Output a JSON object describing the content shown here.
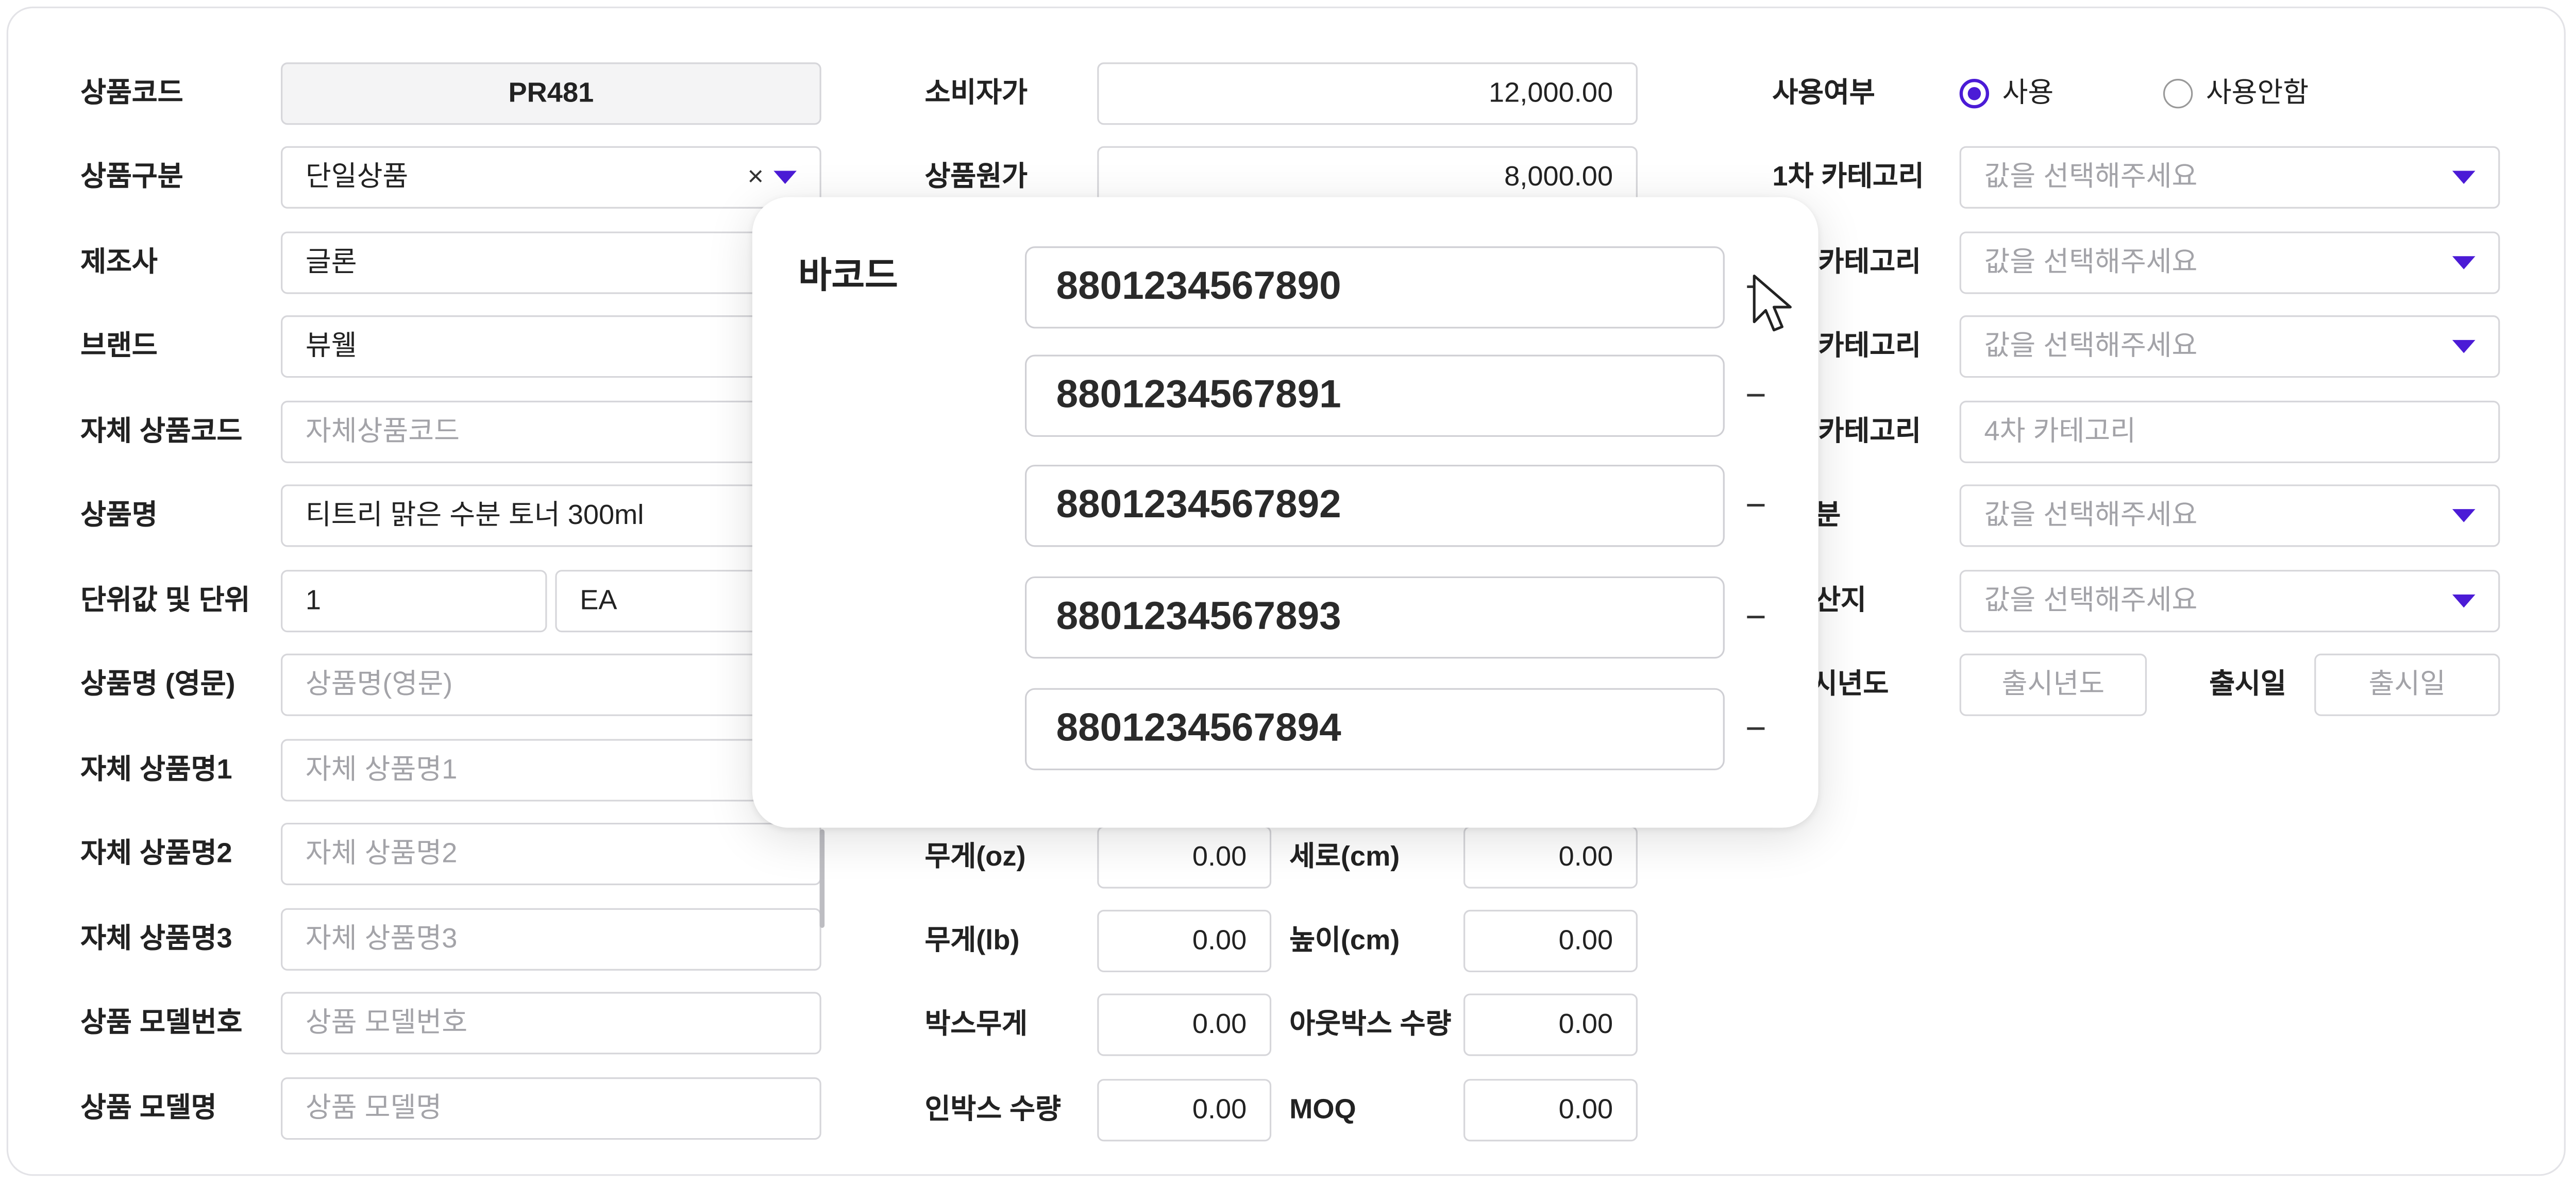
{
  "left": {
    "product_code": {
      "label": "상품코드",
      "value": "PR481"
    },
    "product_type": {
      "label": "상품구분",
      "value": "단일상품",
      "clear": "×"
    },
    "manufacturer": {
      "label": "제조사",
      "value": "글론"
    },
    "brand": {
      "label": "브랜드",
      "value": "뷰웰"
    },
    "own_code": {
      "label": "자체 상품코드",
      "placeholder": "자체상품코드"
    },
    "product_name": {
      "label": "상품명",
      "value": "티트리 맑은 수분 토너 300ml"
    },
    "unit": {
      "label": "단위값 및 단위",
      "value": "1",
      "unit_value": "EA"
    },
    "name_en": {
      "label": "상품명 (영문)",
      "placeholder": "상품명(영문)"
    },
    "own_name1": {
      "label": "자체 상품명1",
      "placeholder": "자체 상품명1"
    },
    "own_name2": {
      "label": "자체 상품명2",
      "placeholder": "자체 상품명2"
    },
    "own_name3": {
      "label": "자체 상품명3",
      "placeholder": "자체 상품명3"
    },
    "model_no": {
      "label": "상품 모델번호",
      "placeholder": "상품 모델번호"
    },
    "model_name": {
      "label": "상품 모델명",
      "placeholder": "상품 모델명"
    }
  },
  "middle": {
    "consumer_price": {
      "label": "소비자가",
      "value": "12,000.00"
    },
    "cost_price": {
      "label": "상품원가",
      "value": "8,000.00"
    },
    "weight_oz": {
      "label": "무게(oz)",
      "value": "0.00"
    },
    "depth_cm": {
      "label": "세로(cm)",
      "value": "0.00"
    },
    "weight_lb": {
      "label": "무게(lb)",
      "value": "0.00"
    },
    "height_cm": {
      "label": "높이(cm)",
      "value": "0.00"
    },
    "box_weight": {
      "label": "박스무게",
      "value": "0.00"
    },
    "outbox_qty": {
      "label": "아웃박스 수량",
      "value": "0.00"
    },
    "inbox_qty": {
      "label": "인박스 수량",
      "value": "0.00"
    },
    "moq": {
      "label": "MOQ",
      "value": "0.00"
    }
  },
  "right": {
    "use": {
      "label": "사용여부",
      "opt_on": "사용",
      "opt_off": "사용안함",
      "selected": "사용"
    },
    "cat1": {
      "label": "1차 카테고리",
      "placeholder": "값을 선택해주세요"
    },
    "cat2": {
      "label": "카테고리",
      "placeholder": "값을 선택해주세요"
    },
    "cat3": {
      "label": "카테고리",
      "placeholder": "값을 선택해주세요"
    },
    "cat4": {
      "label": "카테고리",
      "placeholder": "4차 카테고리"
    },
    "row5": {
      "label": "분",
      "placeholder": "값을 선택해주세요"
    },
    "row6": {
      "label": "산지",
      "placeholder": "값을 선택해주세요"
    },
    "release_year": {
      "label": "시년도",
      "placeholder": "출시년도"
    },
    "release_day": {
      "label": "출시일",
      "placeholder": "출시일"
    }
  },
  "barcode_popup": {
    "label": "바코드",
    "add_symbol": "+",
    "remove_symbol": "−",
    "barcodes": [
      "8801234567890",
      "8801234567891",
      "8801234567892",
      "8801234567893",
      "8801234567894"
    ]
  },
  "colors": {
    "accent": "#4b1bd6",
    "border": "#d6d6da",
    "placeholder": "#a3a3a8"
  }
}
